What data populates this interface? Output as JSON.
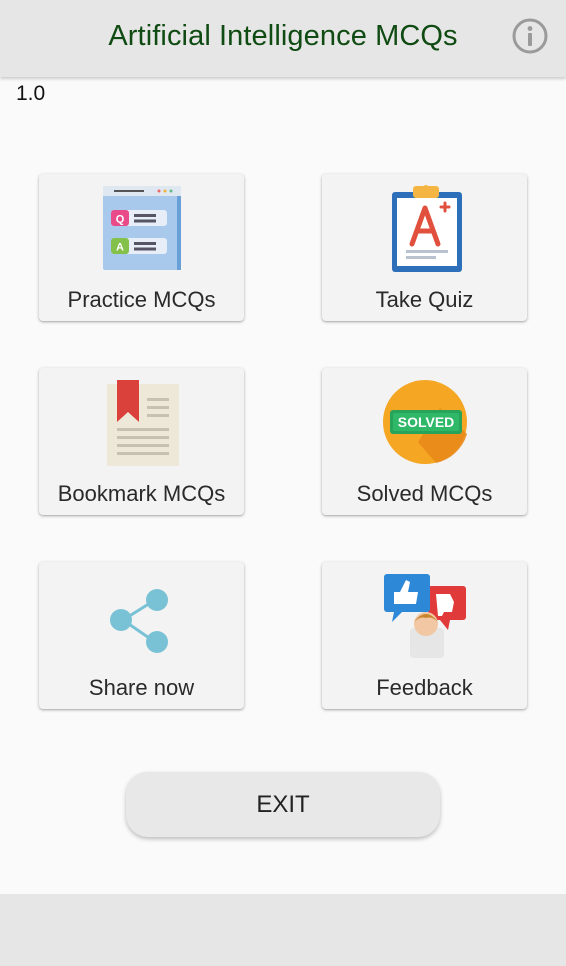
{
  "header": {
    "title": "Artificial Intelligence MCQs",
    "info_icon": "info-circle-icon"
  },
  "version": "1.0",
  "menu": [
    {
      "label": "Practice MCQs",
      "icon": "qa-cards-icon"
    },
    {
      "label": "Take Quiz",
      "icon": "clipboard-grade-icon"
    },
    {
      "label": "Bookmark MCQs",
      "icon": "bookmark-page-icon"
    },
    {
      "label": "Solved MCQs",
      "icon": "solved-badge-icon",
      "badge_text": "SOLVED"
    },
    {
      "label": "Share now",
      "icon": "share-icon"
    },
    {
      "label": "Feedback",
      "icon": "feedback-thumbs-icon"
    }
  ],
  "exit_label": "EXIT",
  "colors": {
    "title": "#0f4b12",
    "appbar": "#e6e6e6",
    "card": "#f3f3f3",
    "share": "#79c2d6"
  }
}
